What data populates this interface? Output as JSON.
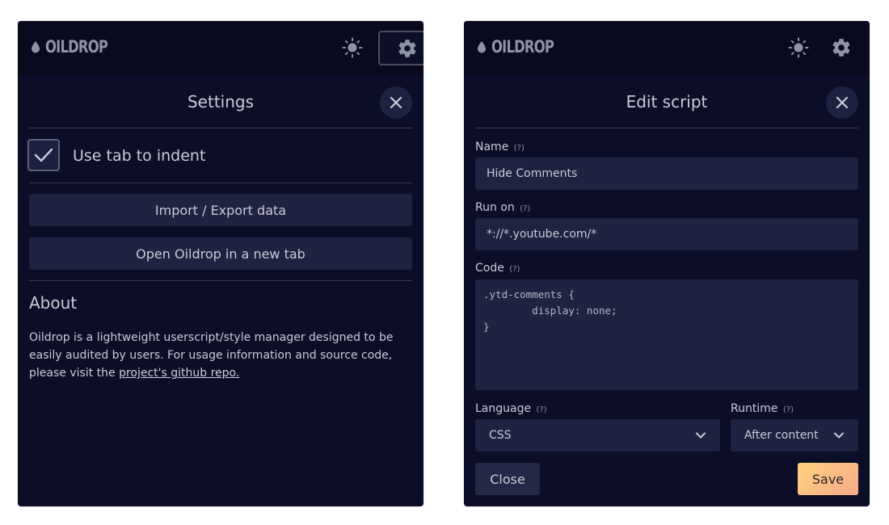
{
  "colors": {
    "panel_bg": "#0c0e27",
    "topbar_bg": "#090a1d",
    "input_bg": "#1f2241",
    "text": "#c9cad6",
    "save_gradient_start": "#ffd27d",
    "save_gradient_end": "#f7a98a"
  },
  "left": {
    "brand": "OILDROP",
    "icons": [
      "oil-drop-icon",
      "sun-icon",
      "gear-icon",
      "close-icon",
      "checkmark-icon"
    ],
    "title": "Settings",
    "checkbox": {
      "label": "Use tab to indent",
      "checked": true
    },
    "buttons": {
      "import_export": "Import / Export data",
      "open_new_tab": "Open Oildrop in a new tab"
    },
    "about": {
      "title": "About",
      "text": "Oildrop is a lightweight userscript/style manager designed to be easily audited by users. For usage information and source code, please visit the ",
      "link": "project's github repo."
    }
  },
  "right": {
    "brand": "OILDROP",
    "icons": [
      "oil-drop-icon",
      "sun-icon",
      "gear-icon",
      "close-icon",
      "chevron-down-icon"
    ],
    "title": "Edit script",
    "hint": "(?)",
    "name": {
      "label": "Name",
      "value": "Hide Comments"
    },
    "run_on": {
      "label": "Run on",
      "value": "*://*.youtube.com/*"
    },
    "code": {
      "label": "Code",
      "value": ".ytd-comments {\n        display: none;\n}"
    },
    "language": {
      "label": "Language",
      "value": "CSS"
    },
    "runtime": {
      "label": "Runtime",
      "value": "After content"
    },
    "close_label": "Close",
    "save_label": "Save"
  }
}
